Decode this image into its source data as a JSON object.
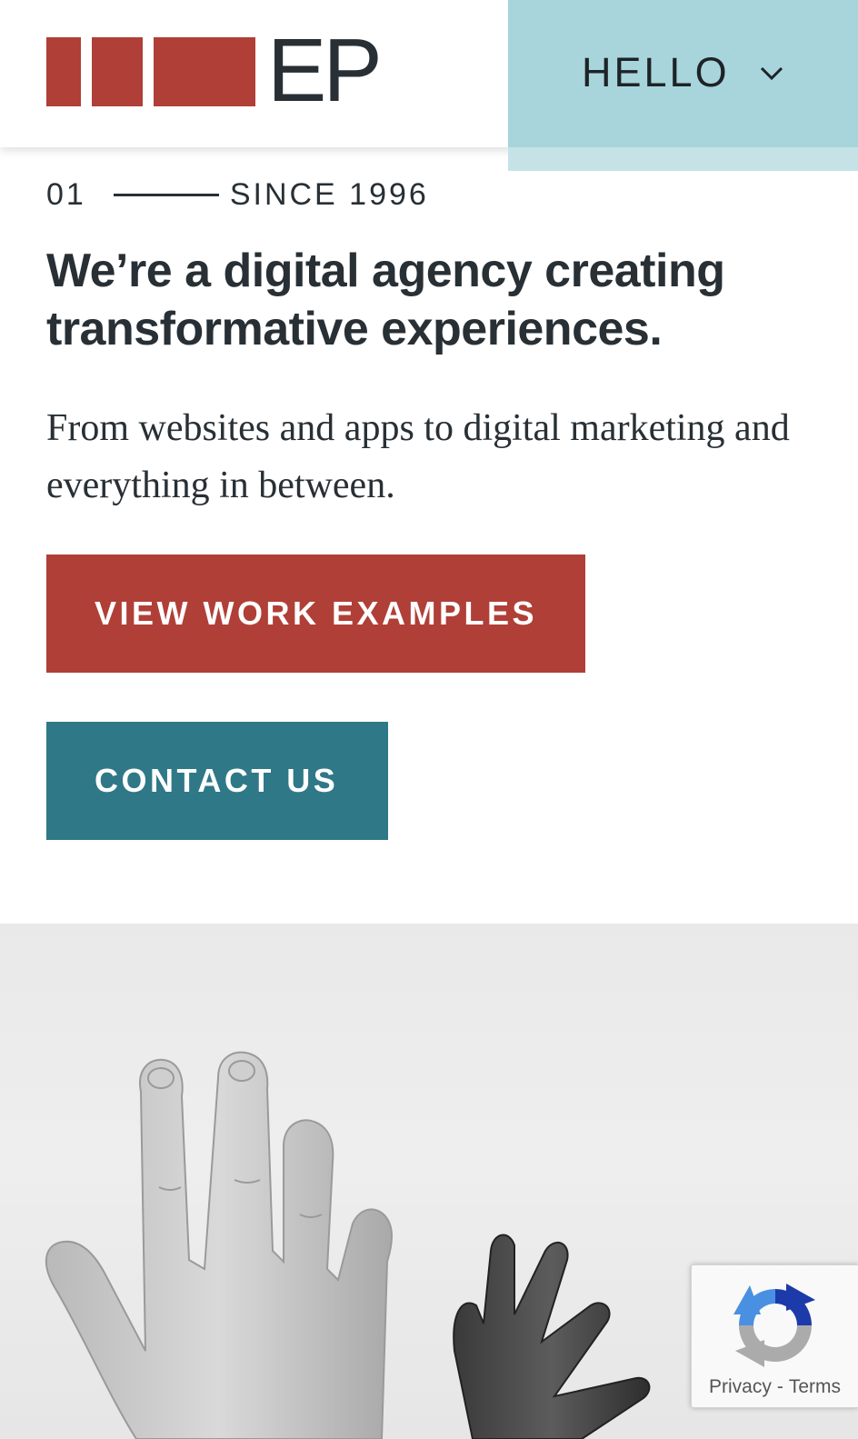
{
  "colors": {
    "brand_red": "#b03f37",
    "brand_teal": "#2f7887",
    "hello_panel": "#a7d5db",
    "text_dark": "#283035"
  },
  "header": {
    "logo": {
      "text": "EP",
      "blocks": 3
    },
    "menu": {
      "label": "HELLO",
      "icon": "chevron-down-icon"
    }
  },
  "hero": {
    "eyebrow": {
      "number": "01",
      "text": "SINCE 1996"
    },
    "headline": "We’re a digital agency creating transformative experiences.",
    "subhead": "From websites and apps to digital marketing and everything in between.",
    "buttons": {
      "work_label": "VIEW WORK EXAMPLES",
      "contact_label": "CONTACT US"
    },
    "image": {
      "subject": "raised-hands-photo"
    }
  },
  "recaptcha": {
    "icon": "recaptcha-icon",
    "privacy_label": "Privacy",
    "separator": "-",
    "terms_label": "Terms"
  }
}
